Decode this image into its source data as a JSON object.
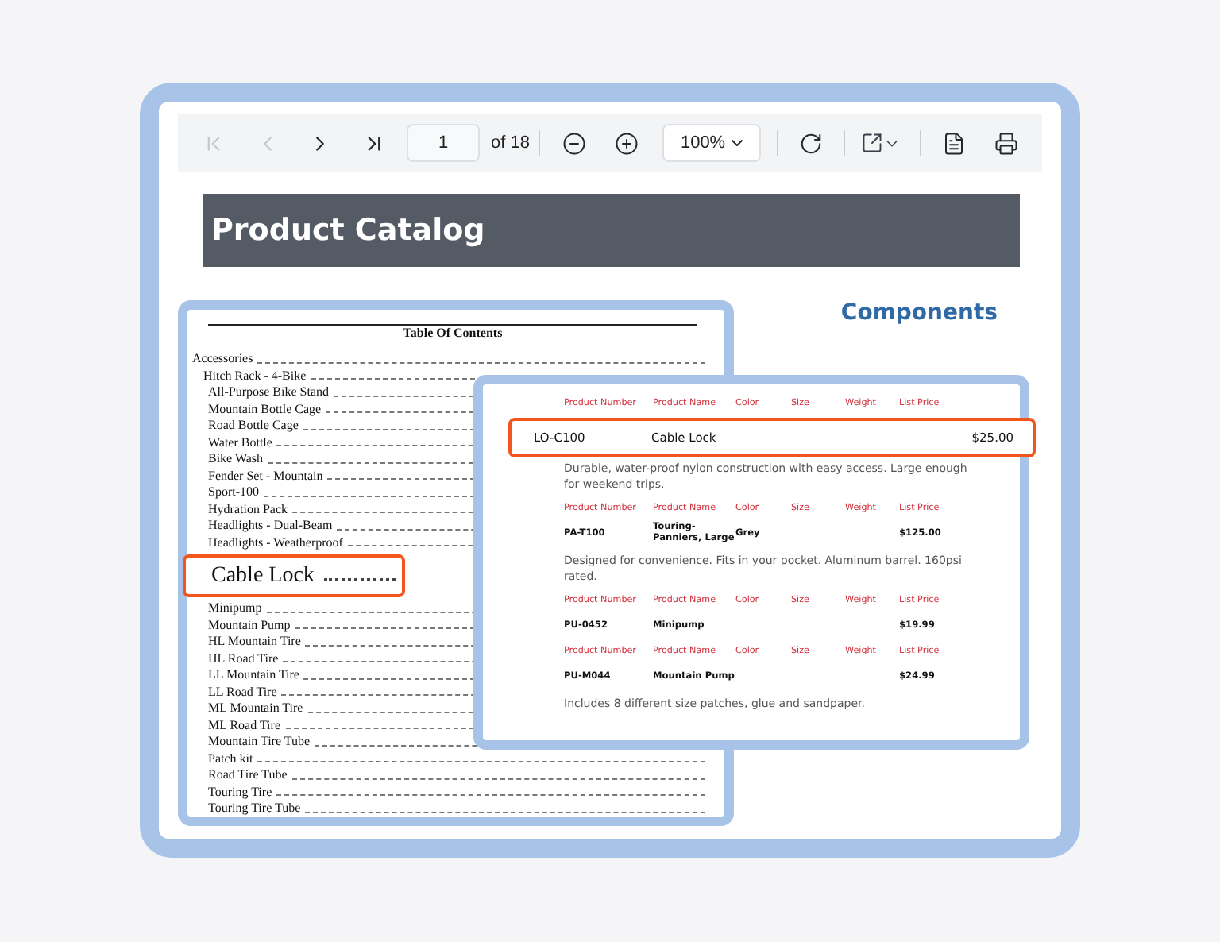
{
  "toolbar": {
    "buttons": [
      {
        "kind": "first",
        "disabled": true
      },
      {
        "kind": "prev",
        "disabled": true
      },
      {
        "kind": "next",
        "disabled": false
      },
      {
        "kind": "last",
        "disabled": false
      }
    ],
    "page": "1",
    "page_count": "of 18",
    "zoom": "100%"
  },
  "document": {
    "title": "Product Catalog",
    "section": "Components",
    "toc": {
      "title": "Table Of Contents",
      "items": [
        {
          "label": "Accessories",
          "children": [
            {
              "label": "Hitch Rack - 4-Bike",
              "children": [
                {
                  "label": "All-Purpose Bike Stand"
                },
                {
                  "label": "Mountain Bottle Cage"
                },
                {
                  "label": "Road Bottle Cage"
                },
                {
                  "label": "Water Bottle"
                },
                {
                  "label": "Bike Wash"
                },
                {
                  "label": "Fender Set - Mountain"
                },
                {
                  "label": "Sport-100"
                },
                {
                  "label": "Hydration Pack"
                },
                {
                  "label": "Headlights - Dual-Beam"
                },
                {
                  "label": "Headlights - Weatherproof"
                },
                {
                  "label": "Cable Lock",
                  "highlighted": true
                },
                {
                  "label": "Minipump"
                },
                {
                  "label": "Mountain Pump"
                },
                {
                  "label": "HL Mountain Tire"
                },
                {
                  "label": "HL Road Tire"
                },
                {
                  "label": "LL Mountain Tire"
                },
                {
                  "label": "LL Road Tire"
                },
                {
                  "label": "ML Mountain Tire"
                },
                {
                  "label": "ML Road Tire"
                },
                {
                  "label": "Mountain Tire Tube"
                },
                {
                  "label": "Patch kit"
                },
                {
                  "label": "Road Tire Tube"
                },
                {
                  "label": "Touring Tire"
                },
                {
                  "label": "Touring Tire Tube"
                }
              ]
            }
          ]
        }
      ]
    },
    "products": [
      {
        "columns": [
          "Product Number",
          "Product Name",
          "Color",
          "Size",
          "Weight",
          "List Price"
        ],
        "number": "LO-C100",
        "name": "Cable Lock",
        "price": "$25.00",
        "highlighted": true,
        "description": "Durable, water-proof nylon construction with easy access. Large enough for weekend trips."
      },
      {
        "columns": [
          "Product Number",
          "Product Name",
          "Color",
          "Size",
          "Weight",
          "List Price"
        ],
        "number": "PA-T100",
        "name": "Touring-Panniers, Large",
        "shade": "Grey",
        "price": "$125.00",
        "highlighted": false,
        "description": "Designed for convenience. Fits in your pocket. Aluminum barrel. 160psi rated."
      },
      {
        "columns": [
          "Product Number",
          "Product Name",
          "Color",
          "Size",
          "Weight",
          "List Price"
        ],
        "number": "PU-0452",
        "name": "Minipump",
        "price": "$19.99",
        "highlighted": false
      },
      {
        "columns": [
          "Product Number",
          "Product Name",
          "Color",
          "Size",
          "Weight",
          "List Price"
        ],
        "number": "PU-M044",
        "name": "Mountain Pump",
        "price": "$24.99",
        "highlighted": false,
        "description": "Includes 8 different size patches, glue and sandpaper."
      }
    ]
  }
}
